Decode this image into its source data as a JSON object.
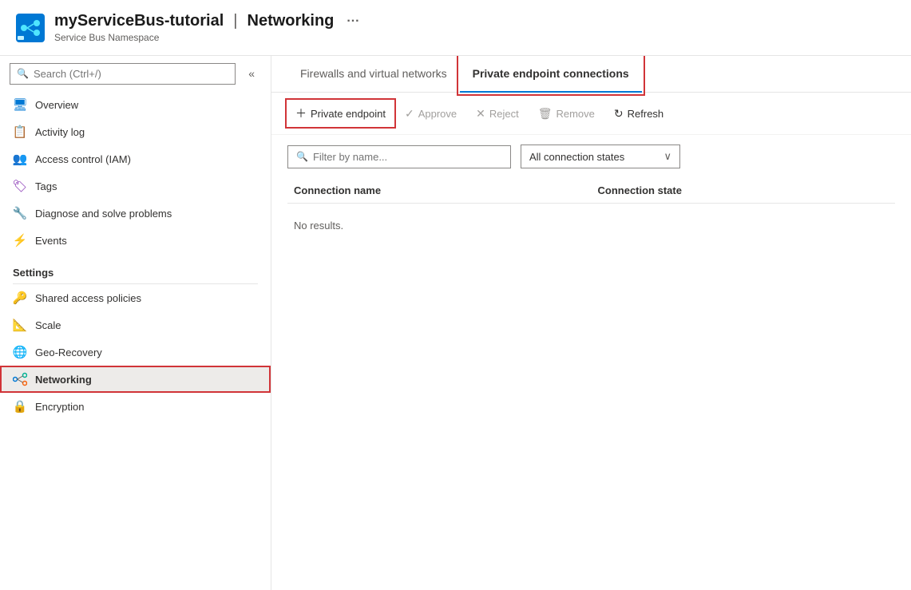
{
  "header": {
    "title": "myServiceBus-tutorial",
    "separator": "|",
    "page": "Networking",
    "subtitle": "Service Bus Namespace",
    "menu_dots": "···"
  },
  "sidebar": {
    "search_placeholder": "Search (Ctrl+/)",
    "collapse_icon": "«",
    "nav_items": [
      {
        "id": "overview",
        "label": "Overview",
        "icon": "🖥",
        "active": false
      },
      {
        "id": "activity-log",
        "label": "Activity log",
        "icon": "📋",
        "active": false
      },
      {
        "id": "access-control",
        "label": "Access control (IAM)",
        "icon": "👥",
        "active": false
      },
      {
        "id": "tags",
        "label": "Tags",
        "icon": "🏷",
        "active": false
      },
      {
        "id": "diagnose",
        "label": "Diagnose and solve problems",
        "icon": "🔧",
        "active": false
      },
      {
        "id": "events",
        "label": "Events",
        "icon": "⚡",
        "active": false
      }
    ],
    "settings_label": "Settings",
    "settings_items": [
      {
        "id": "shared-access",
        "label": "Shared access policies",
        "icon": "🔑",
        "active": false
      },
      {
        "id": "scale",
        "label": "Scale",
        "icon": "📐",
        "active": false
      },
      {
        "id": "geo-recovery",
        "label": "Geo-Recovery",
        "icon": "🌐",
        "active": false
      },
      {
        "id": "networking",
        "label": "Networking",
        "icon": "🔀",
        "active": true,
        "highlighted": true
      },
      {
        "id": "encryption",
        "label": "Encryption",
        "icon": "🔒",
        "active": false
      }
    ]
  },
  "tabs": [
    {
      "id": "firewalls",
      "label": "Firewalls and virtual networks",
      "active": false
    },
    {
      "id": "private-endpoints",
      "label": "Private endpoint connections",
      "active": true,
      "highlighted": true
    }
  ],
  "toolbar": {
    "add_label": "Private endpoint",
    "approve_label": "Approve",
    "reject_label": "Reject",
    "remove_label": "Remove",
    "refresh_label": "Refresh"
  },
  "filter": {
    "placeholder": "Filter by name...",
    "dropdown_label": "All connection states",
    "dropdown_icon": "∨"
  },
  "table": {
    "col_name": "Connection name",
    "col_state": "Connection state",
    "no_results": "No results."
  }
}
